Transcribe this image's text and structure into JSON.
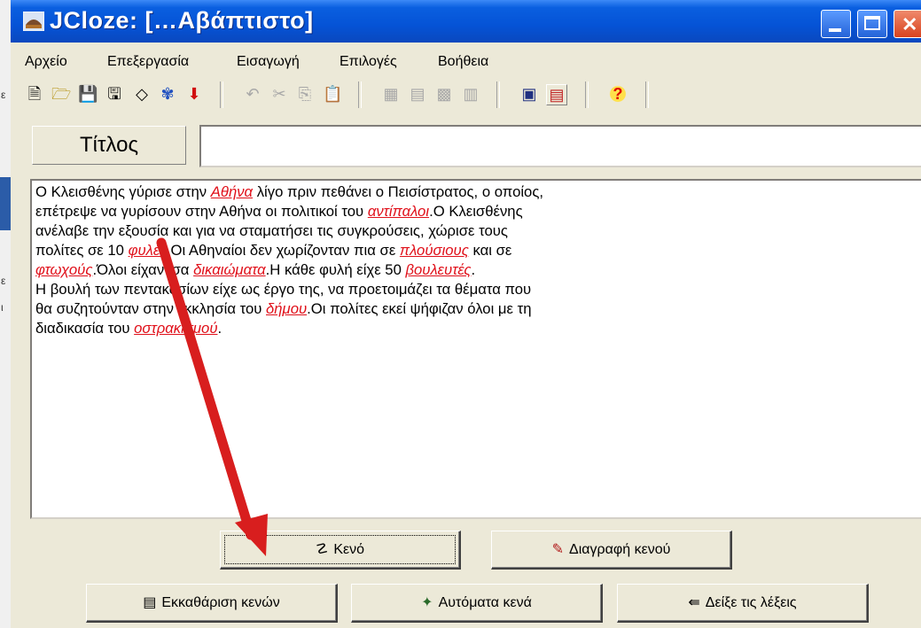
{
  "window": {
    "title": "JCloze: […Αβάπτιστο]"
  },
  "menu": [
    "Αρχείο",
    "Επεξεργασία",
    "Εισαγωγή",
    "Επιλογές",
    "Βοήθεια"
  ],
  "title_field": {
    "label": "Τίτλος",
    "value": ""
  },
  "editor": {
    "lines": [
      [
        {
          "t": "Ο Κλεισθένης γύρισε στην "
        },
        {
          "t": "Αθήνα",
          "gap": true
        },
        {
          "t": " λίγο πριν πεθάνει ο Πεισίστρατος, ο οποίος,"
        }
      ],
      [
        {
          "t": "επέτρεψε να γυρίσουν στην Αθήνα οι πολιτικοί του "
        },
        {
          "t": "αντίπαλοι",
          "gap": true
        },
        {
          "t": ".Ο Κλεισθένης"
        }
      ],
      [
        {
          "t": "ανέλαβε την εξουσία και για να σταματήσει τις συγκρούσεις, χώρισε τους"
        }
      ],
      [
        {
          "t": "πολίτες σε 10 "
        },
        {
          "t": "φυλές",
          "gap": true
        },
        {
          "t": ".Οι Αθηναίοι δεν χωρίζονταν πια σε "
        },
        {
          "t": "πλούσιους",
          "gap": true
        },
        {
          "t": " και σε"
        }
      ],
      [
        {
          "t": "φτωχούς",
          "gap": true
        },
        {
          "t": ".Όλοι είχαν ίσα "
        },
        {
          "t": "δικαιώματα",
          "gap": true
        },
        {
          "t": ".Η κάθε φυλή είχε 50 "
        },
        {
          "t": "βουλευτές",
          "gap": true
        },
        {
          "t": "."
        }
      ],
      [
        {
          "t": "Η βουλή των πεντακοσίων είχε ως έργο της, να προετοιμάζει τα θέματα που"
        }
      ],
      [
        {
          "t": "θα συζητούνταν στην εκκλησία του "
        },
        {
          "t": "δήμου",
          "gap": true
        },
        {
          "t": ".Οι πολίτες εκεί ψήφιζαν όλοι με τη"
        }
      ],
      [
        {
          "t": "διαδικασία του "
        },
        {
          "t": "οστρακισμού",
          "gap": true
        },
        {
          "t": "."
        }
      ]
    ]
  },
  "buttons": {
    "gap": "Κενό",
    "delete_gap": "Διαγραφή κενού",
    "clear_gaps": "Εκκαθάριση κενών",
    "auto_gaps": "Αυτόματα κενά",
    "show_words": "Δείξε τις λέξεις"
  },
  "colors": {
    "titlebar": "#0553d6",
    "gap_word": "#e0101a",
    "arrow": "#d81e1e"
  }
}
